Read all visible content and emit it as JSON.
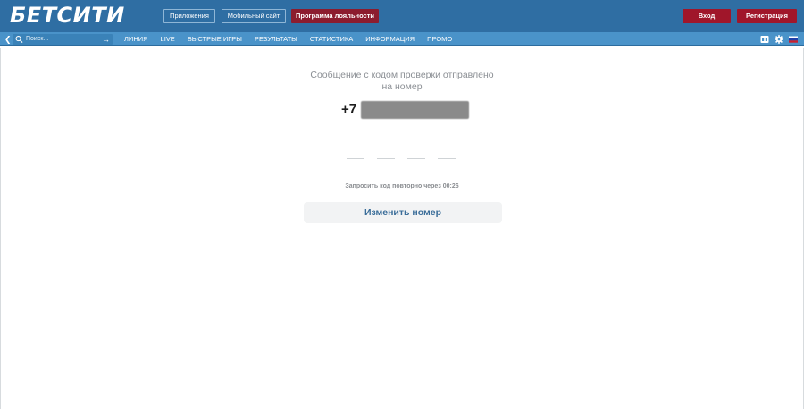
{
  "header": {
    "logo_text": "БЕТСИТИ",
    "apps_label": "Приложения",
    "mobile_label": "Мобильный сайт",
    "loyalty_label": "Программа лояльности",
    "login_label": "Вход",
    "register_label": "Регистрация"
  },
  "nav": {
    "search_placeholder": "Поиск...",
    "items": [
      {
        "label": "ЛИНИЯ"
      },
      {
        "label": "LIVE"
      },
      {
        "label": "БЫСТРЫЕ ИГРЫ"
      },
      {
        "label": "РЕЗУЛЬТАТЫ"
      },
      {
        "label": "СТАТИСТИКА"
      },
      {
        "label": "ИНФОРМАЦИЯ"
      },
      {
        "label": "ПРОМО"
      }
    ],
    "icons": [
      "scoreboard-icon",
      "gear-icon",
      "russian-flag-icon"
    ]
  },
  "verification": {
    "message_line1": "Сообщение с кодом проверки отправлено",
    "message_line2": "на номер",
    "phone_prefix": "+7",
    "resend_text": "Запросить код повторно через 00:26",
    "change_number_label": "Изменить номер"
  },
  "colors": {
    "header_bg": "#2f6ea3",
    "nav_bg": "#4a93c9",
    "accent_red": "#a0162a",
    "loyalty_red": "#8c1c2e",
    "link_blue": "#3a6d99"
  }
}
